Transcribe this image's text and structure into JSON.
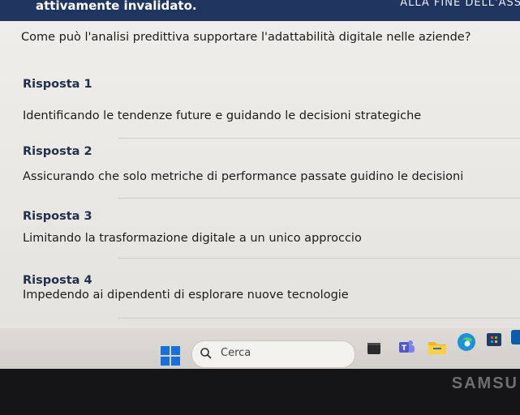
{
  "topbar": {
    "notice": "attivamente invalidato.",
    "end_label": "ALLA FINE DELL'ASS"
  },
  "question": "Come può l'analisi predittiva supportare l'adattabilità digitale nelle aziende?",
  "answers": [
    {
      "label": "Risposta 1",
      "text": "Identificando le tendenze future e guidando le decisioni strategiche"
    },
    {
      "label": "Risposta 2",
      "text": "Assicurando che solo metriche di performance passate guidino le decisioni"
    },
    {
      "label": "Risposta 3",
      "text": "Limitando la trasformazione digitale a un unico approccio"
    },
    {
      "label": "Risposta 4",
      "text": "Impedendo ai dipendenti di esplorare nuove tecnologie"
    }
  ],
  "taskbar": {
    "search_placeholder": "Cerca",
    "icons": [
      "windows-start-icon",
      "search-icon",
      "terminal-icon",
      "teams-icon",
      "file-explorer-icon",
      "edge-icon",
      "store-icon",
      "app-icon"
    ]
  },
  "bezel": {
    "brand": "SAMSU"
  },
  "colors": {
    "topbar": "#1f3560",
    "answer_label": "#22304d",
    "windows_blue": "#1a6fd8"
  }
}
